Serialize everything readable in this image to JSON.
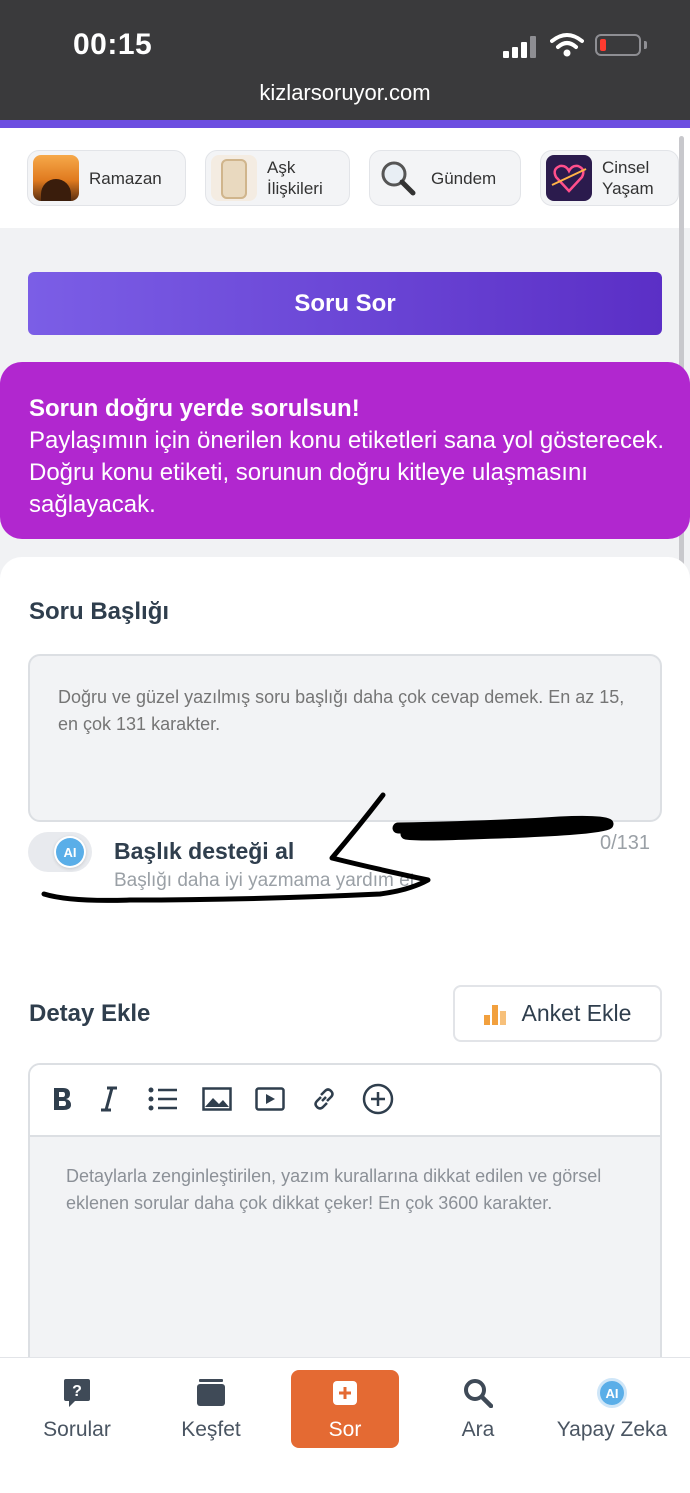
{
  "status_bar": {
    "time": "00:15",
    "url": "kizlarsoruyor.com"
  },
  "topics": [
    {
      "label": "Ramazan",
      "icon": "mosque-sunset-image"
    },
    {
      "label": "Aşk İlişkileri",
      "icon": "couple-image"
    },
    {
      "label": "Gündem",
      "icon": "magnifier-image"
    },
    {
      "label": "Cinsel Yaşam",
      "icon": "neon-heart-image"
    }
  ],
  "ask_button": {
    "label": "Soru Sor"
  },
  "banner": {
    "title": "Sorun doğru yerde sorulsun!",
    "text": "Paylaşımın için önerilen konu etiketleri sana yol gösterecek. Doğru konu etiketi, sorunun doğru kitleye ulaşmasını sağlayacak."
  },
  "question_title": {
    "label": "Soru Başlığı",
    "placeholder": "Doğru ve güzel yazılmış soru başlığı daha çok cevap demek. En az 15, en çok 131 karakter.",
    "counter": "0/131"
  },
  "title_assist": {
    "icon_text": "AI",
    "title": "Başlık desteği al",
    "subtitle": "Başlığı daha iyi yazmama yardım et."
  },
  "details": {
    "label": "Detay Ekle",
    "poll_button": "Anket Ekle",
    "placeholder": "Detaylarla zenginleştirilen, yazım kurallarına dikkat edilen ve görsel eklenen sorular daha çok dikkat çeker! En çok 3600 karakter.",
    "toolbar": [
      "bold-icon",
      "italic-icon",
      "list-icon",
      "image-icon",
      "video-icon",
      "link-icon",
      "add-icon"
    ]
  },
  "bottom_nav": {
    "items": [
      {
        "label": "Sorular",
        "icon": "question-bubble-icon"
      },
      {
        "label": "Keşfet",
        "icon": "explore-stack-icon"
      },
      {
        "label": "Sor",
        "icon": "plus-square-icon"
      },
      {
        "label": "Ara",
        "icon": "search-icon"
      },
      {
        "label": "Yapay Zeka",
        "icon": "ai-icon"
      }
    ],
    "ai_icon_text": "AI",
    "active_index": 2
  },
  "colors": {
    "accent_purple": "#6c4ee0",
    "banner_magenta": "#b127cf",
    "active_orange": "#e46a33",
    "poll_orange": "#f2a03d"
  }
}
